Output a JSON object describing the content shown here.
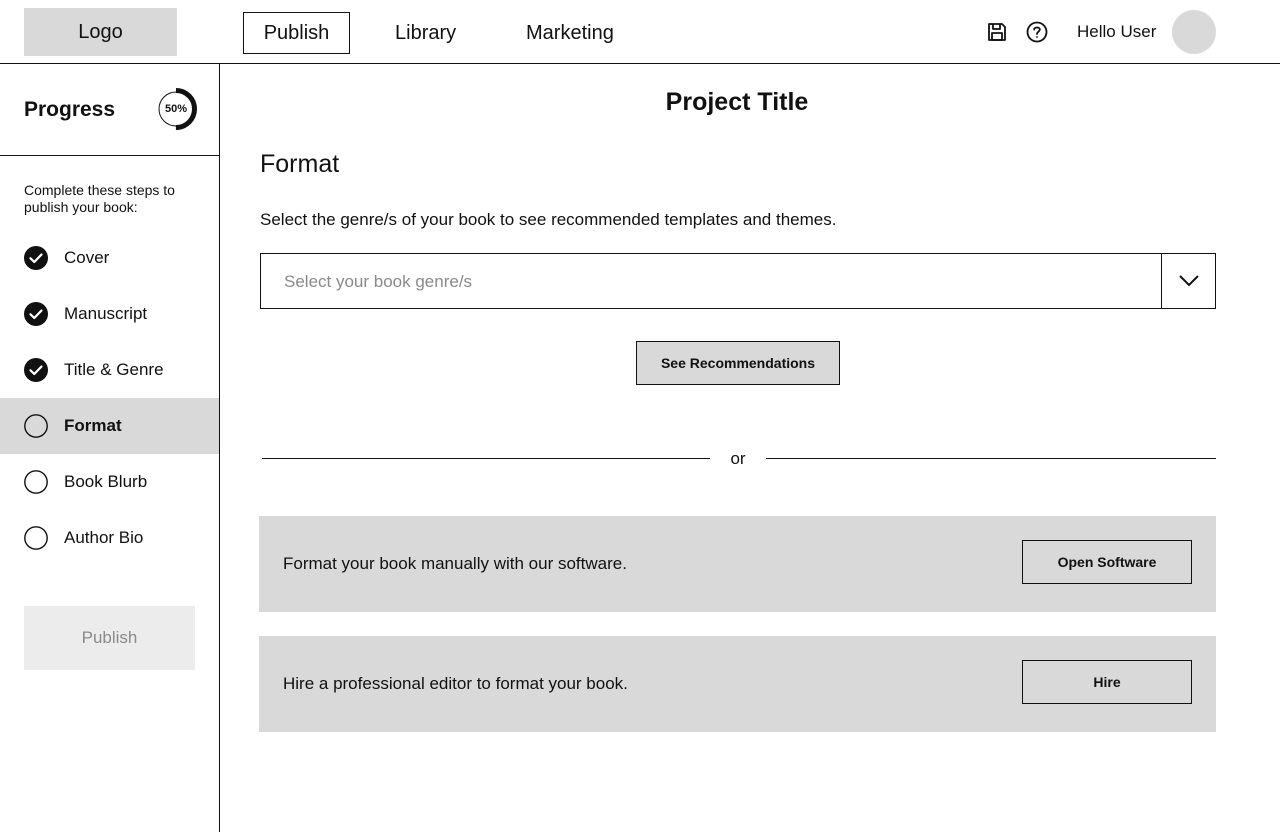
{
  "header": {
    "logo": "Logo",
    "tabs": [
      {
        "label": "Publish",
        "active": true
      },
      {
        "label": "Library",
        "active": false
      },
      {
        "label": "Marketing",
        "active": false
      }
    ],
    "icons": [
      "save-icon",
      "help-icon"
    ],
    "greeting": "Hello User"
  },
  "sidebar": {
    "progress_title": "Progress",
    "progress_value": 0.5,
    "progress_label": "50%",
    "intro": "Complete these steps to publish your book:",
    "steps": [
      {
        "label": "Cover",
        "done": true
      },
      {
        "label": "Manuscript",
        "done": true
      },
      {
        "label": "Title & Genre",
        "done": true
      },
      {
        "label": "Format",
        "done": false,
        "current": true
      },
      {
        "label": "Book Blurb",
        "done": false
      },
      {
        "label": "Author Bio",
        "done": false
      }
    ],
    "publish_label": "Publish"
  },
  "main": {
    "project_title": "Project Title",
    "section_title": "Format",
    "description": "Select the genre/s of your book to see recommended templates and themes.",
    "genre_placeholder": "Select your book genre/s",
    "recommend_button": "See Recommendations",
    "divider": "or",
    "options": [
      {
        "text": "Format your book manually with our software.",
        "button": "Open Software"
      },
      {
        "text": "Hire a professional editor to format your book.",
        "button": "Hire"
      }
    ]
  },
  "colors": {
    "panel": "#d9d9d9",
    "disabled_bg": "#ececec",
    "disabled_text": "#8a8a8a",
    "ink": "#111111"
  }
}
